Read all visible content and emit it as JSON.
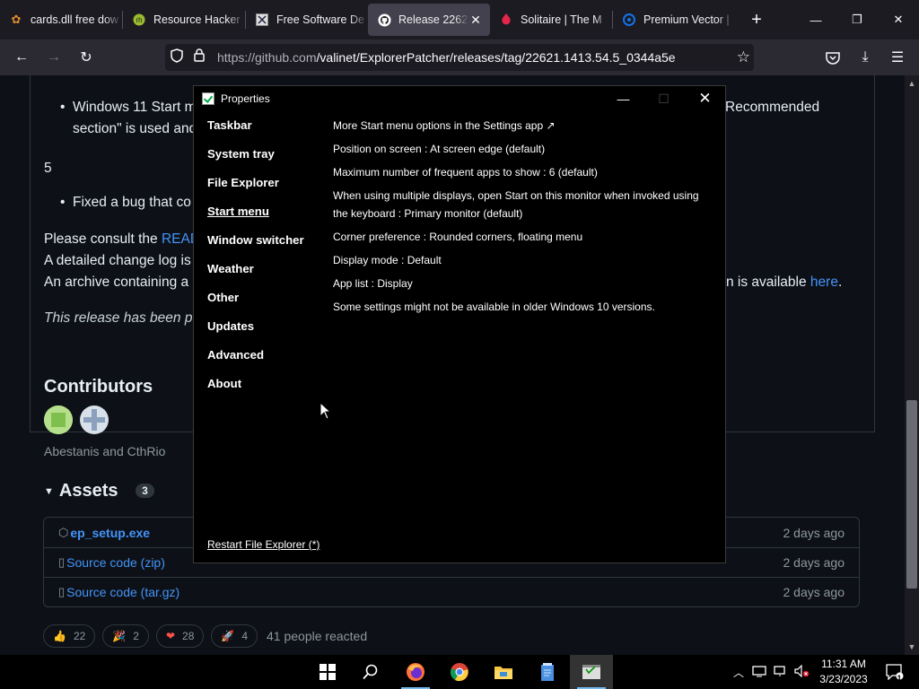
{
  "browser": {
    "tabs": [
      {
        "label": "cards.dll free dow",
        "icon": "gear-favicon"
      },
      {
        "label": "Resource Hacker",
        "icon": "resource-hacker-favicon"
      },
      {
        "label": "Free Software De",
        "icon": "fsd-favicon"
      },
      {
        "label": "Release 22621",
        "icon": "github-favicon",
        "active": true
      },
      {
        "label": "Solitaire | The M",
        "icon": "solitaire-favicon"
      },
      {
        "label": "Premium Vector |",
        "icon": "freepik-favicon"
      }
    ],
    "url_host": "https://github.com",
    "url_path": "/valinet/ExplorerPatcher/releases/tag/22621.1413.54.5_0344a5e"
  },
  "page": {
    "bullet1_line1_start": "Windows 11 Start m",
    "bullet1_line1_end": "Recommended",
    "bullet1_line2": "section\" is used and",
    "item5_number": "5",
    "bullet2": "Fixed a bug that co",
    "consult_prefix": "Please consult the ",
    "consult_link": "READ",
    "changelog_text": "A detailed change log is",
    "archive_text": "An archive containing a",
    "archive_end_text": "n is available ",
    "archive_end_link": "here",
    "archive_end_period": ".",
    "release_note": "This release has been pu",
    "contributors_heading": "Contributors",
    "contributors_names": "Abestanis and CthRio",
    "assets_heading": "Assets",
    "assets_count": "3",
    "assets": [
      {
        "name": "ep_setup.exe",
        "date": "2 days ago",
        "icon": "package-icon",
        "bold": true
      },
      {
        "name": "Source code (zip)",
        "date": "2 days ago",
        "icon": "file-zip-icon",
        "bold": false
      },
      {
        "name": "Source code (tar.gz)",
        "date": "2 days ago",
        "icon": "file-zip-icon",
        "bold": false
      }
    ],
    "reactions": [
      {
        "emoji": "👍",
        "count": "22"
      },
      {
        "emoji": "🎉",
        "count": "2"
      },
      {
        "emoji": "❤",
        "count": "28"
      },
      {
        "emoji": "🚀",
        "count": "4"
      }
    ],
    "reactions_summary": "41 people reacted"
  },
  "dialog": {
    "title": "Properties",
    "nav": [
      {
        "label": "Taskbar",
        "selected": false
      },
      {
        "label": "System tray",
        "selected": false
      },
      {
        "label": "File Explorer",
        "selected": false
      },
      {
        "label": "Start menu",
        "selected": true
      },
      {
        "label": "Window switcher",
        "selected": false
      },
      {
        "label": "Weather",
        "selected": false
      },
      {
        "label": "Other",
        "selected": false
      },
      {
        "label": "Updates",
        "selected": false
      },
      {
        "label": "Advanced",
        "selected": false
      },
      {
        "label": "About",
        "selected": false
      }
    ],
    "options": [
      "More Start menu options in the Settings app ↗",
      "Position on screen : At screen edge (default)",
      "Maximum number of frequent apps to show : 6 (default)",
      "When using multiple displays, open Start on this monitor when invoked using the keyboard : Primary monitor (default)",
      "Corner preference : Rounded corners, floating menu",
      "Display mode : Default",
      "App list : Display",
      "Some settings might not be available in older Windows 10 versions."
    ],
    "restart_label": "Restart File Explorer (*)"
  },
  "taskbar": {
    "time": "11:31 AM",
    "date": "3/23/2023",
    "notification_count": "1",
    "apps": [
      "start-icon",
      "search-icon",
      "firefox-icon",
      "chrome-icon",
      "file-explorer-icon",
      "notepad-icon",
      "properties-app-icon"
    ]
  },
  "colors": {
    "page_bg": "#0d1117",
    "link": "#4493f8",
    "dialog_bg": "#000000",
    "tab_active": "#42414d"
  }
}
